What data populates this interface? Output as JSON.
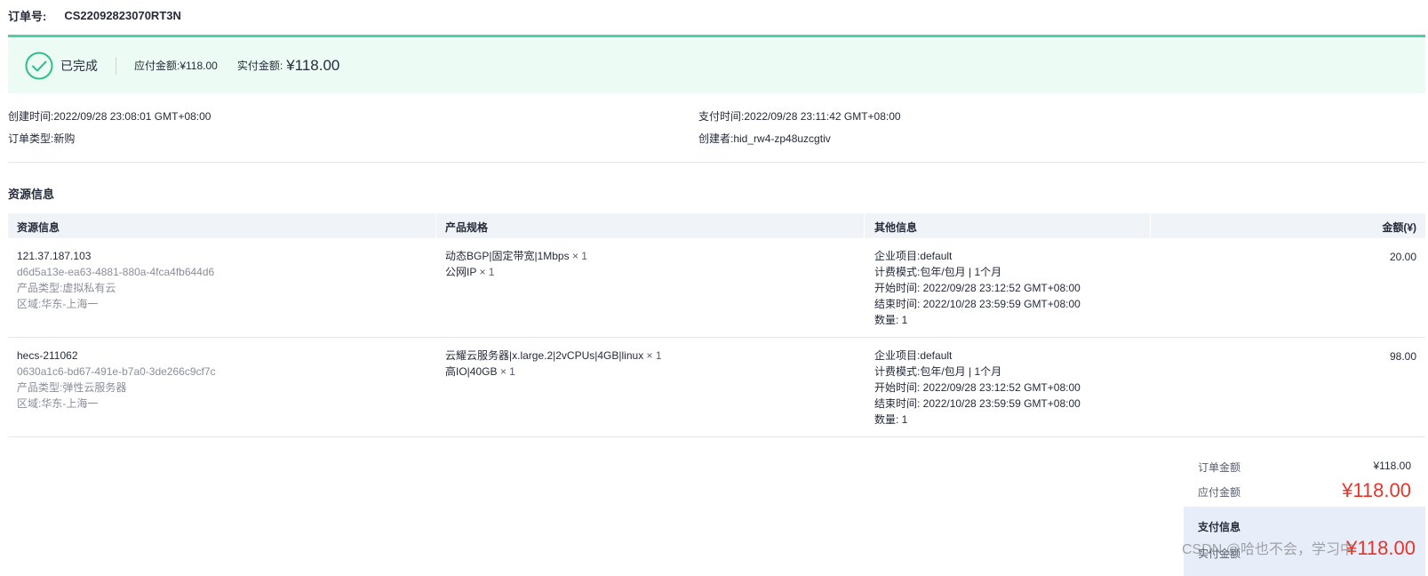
{
  "order": {
    "label": "订单号:",
    "id": "CS22092823070RT3N"
  },
  "status": {
    "text": "已完成",
    "due_label": "应付金额:",
    "due_value": "¥118.00",
    "paid_label": "实付金额:",
    "paid_value": "¥118.00",
    "icon": "check-circle-icon",
    "accent_color": "#4ecdac"
  },
  "meta": {
    "created_label": "创建时间:",
    "created_value": "2022/09/28 23:08:01 GMT+08:00",
    "type_label": "订单类型:",
    "type_value": "新购",
    "paytime_label": "支付时间:",
    "paytime_value": "2022/09/28 23:11:42 GMT+08:00",
    "creator_label": "创建者:",
    "creator_value": "hid_rw4-zp48uzcgtiv"
  },
  "resources": {
    "title": "资源信息",
    "columns": [
      "资源信息",
      "产品规格",
      "其他信息",
      "金额(¥)"
    ],
    "rows": [
      {
        "name": "121.37.187.103",
        "id": "d6d5a13e-ea63-4881-880a-4fca4fb644d6",
        "product_type": "产品类型:虚拟私有云",
        "region": "区域:华东-上海一",
        "spec1": "动态BGP|固定带宽|1Mbps",
        "spec1_qty": "× 1",
        "spec2": "公网IP",
        "spec2_qty": "× 1",
        "other1": "企业项目:default",
        "other2": "计费模式:包年/包月 | 1个月",
        "other3": "开始时间: 2022/09/28 23:12:52 GMT+08:00",
        "other4": "结束时间: 2022/10/28 23:59:59 GMT+08:00",
        "other5": "数量: 1",
        "amount": "20.00"
      },
      {
        "name": "hecs-211062",
        "id": "0630a1c6-bd67-491e-b7a0-3de266c9cf7c",
        "product_type": "产品类型:弹性云服务器",
        "region": "区域:华东-上海一",
        "spec1": "云耀云服务器|x.large.2|2vCPUs|4GB|linux",
        "spec1_qty": "× 1",
        "spec2": "高IO|40GB",
        "spec2_qty": "× 1",
        "other1": "企业项目:default",
        "other2": "计费模式:包年/包月 | 1个月",
        "other3": "开始时间: 2022/09/28 23:12:52 GMT+08:00",
        "other4": "结束时间: 2022/10/28 23:59:59 GMT+08:00",
        "other5": "数量: 1",
        "amount": "98.00"
      }
    ]
  },
  "summary": {
    "order_amount_label": "订单金额",
    "order_amount_value": "¥118.00",
    "due_label": "应付金额",
    "due_value": "¥118.00",
    "payment_title": "支付信息",
    "paid_label": "实付金额",
    "paid_value": "¥118.00",
    "highlight_color": "#e5352b"
  },
  "watermark": "CSDN @哈也不会，学习中"
}
